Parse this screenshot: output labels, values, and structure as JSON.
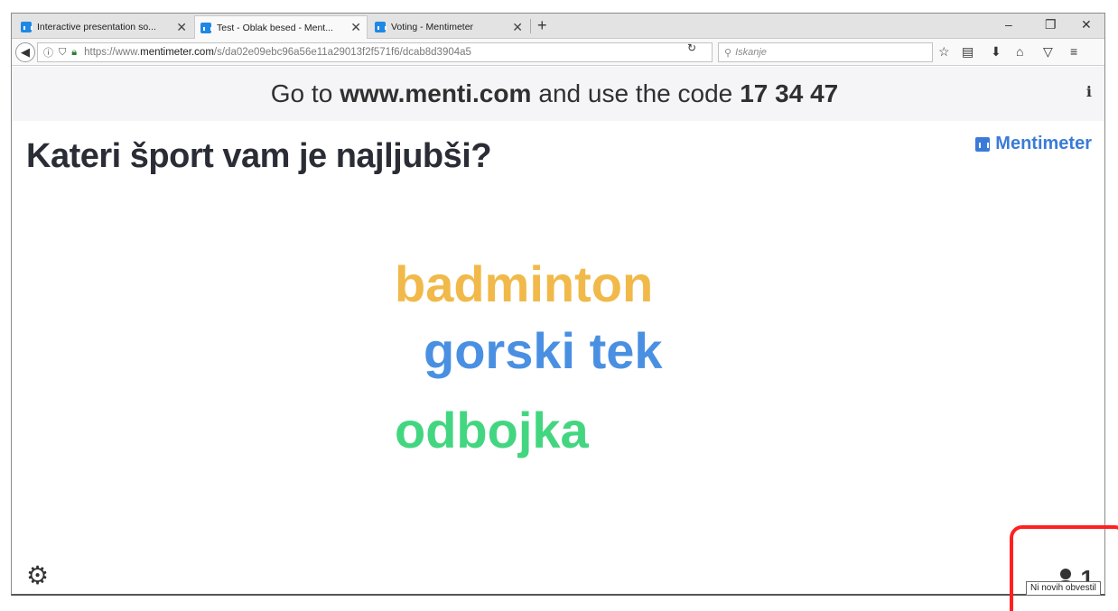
{
  "tabs": [
    {
      "title": "Interactive presentation so...",
      "active": false
    },
    {
      "title": "Test - Oblak besed - Ment...",
      "active": true
    },
    {
      "title": "Voting - Mentimeter",
      "active": false
    }
  ],
  "newtab_label": "+",
  "window_controls": {
    "minimize": "–",
    "restore": "❐",
    "close": "✕"
  },
  "navbar": {
    "url_prefix": "https://www.",
    "url_domain": "mentimeter.com",
    "url_rest": "/s/da02e09ebc96a56e11a29013f2f571f6/dcab8d3904a5",
    "search_placeholder": "Iskanje"
  },
  "page": {
    "instruction_prefix": "Go to",
    "instruction_site": "www.menti.com",
    "instruction_mid": "and use the code",
    "instruction_code": "17 34 47",
    "info_label": "i",
    "question": "Kateri šport vam je najljubši?",
    "logo_text": "Mentimeter",
    "words": [
      {
        "text": "badminton",
        "color": "#f1b949"
      },
      {
        "text": "gorski tek",
        "color": "#4a90e2"
      },
      {
        "text": "odbojka",
        "color": "#43d680"
      }
    ],
    "participant_count": "1",
    "tooltip": "Ni novih obvestil"
  },
  "colors": {
    "highlight": "#ff2020",
    "brand": "#3b7bd8"
  }
}
